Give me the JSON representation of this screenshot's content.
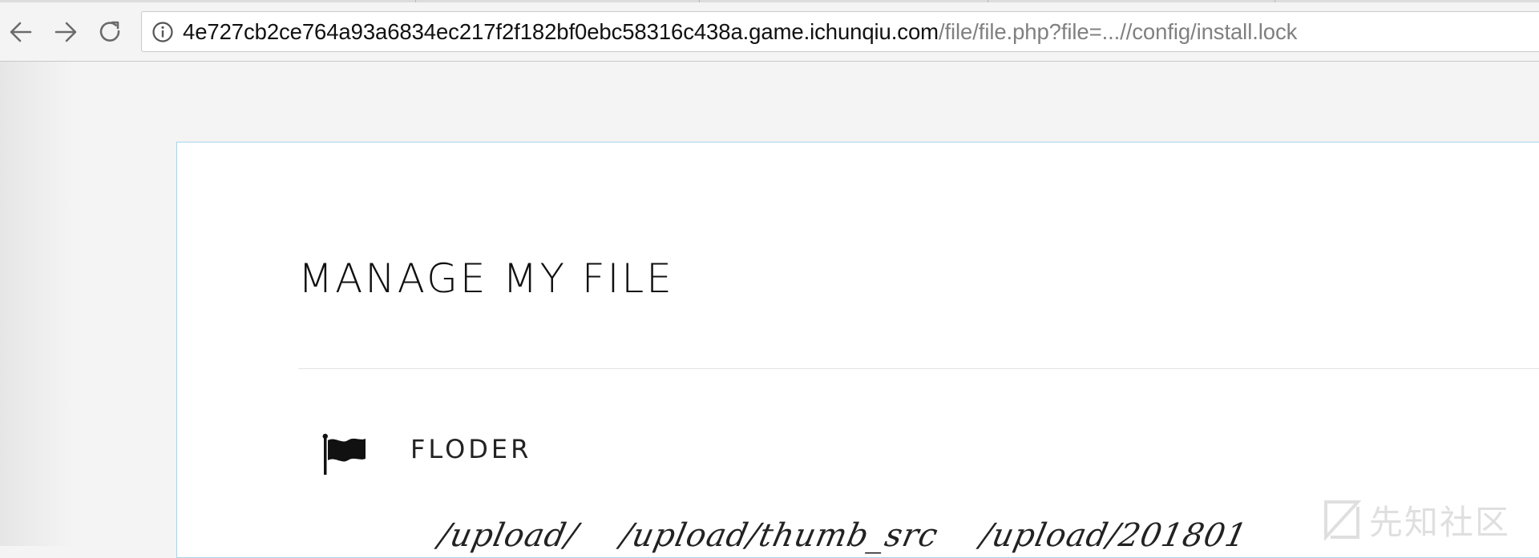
{
  "browser": {
    "url_host": "4e727cb2ce764a93a6834ec217f2f182bf0ebc58316c438a.game.ichunqiu.com",
    "url_path": "/file/file.php?file=...//config/install.lock",
    "icons": {
      "back": "back-arrow-icon",
      "forward": "forward-arrow-icon",
      "reload": "reload-icon",
      "site_info": "info-icon"
    }
  },
  "page": {
    "title": "MANAGE MY FILE",
    "section_label": "FLODER",
    "section_icon": "flag-icon",
    "folders": [
      "/upload/",
      "/upload/thumb_src",
      "/upload/201801"
    ]
  },
  "watermark": {
    "text": "先知社区"
  }
}
